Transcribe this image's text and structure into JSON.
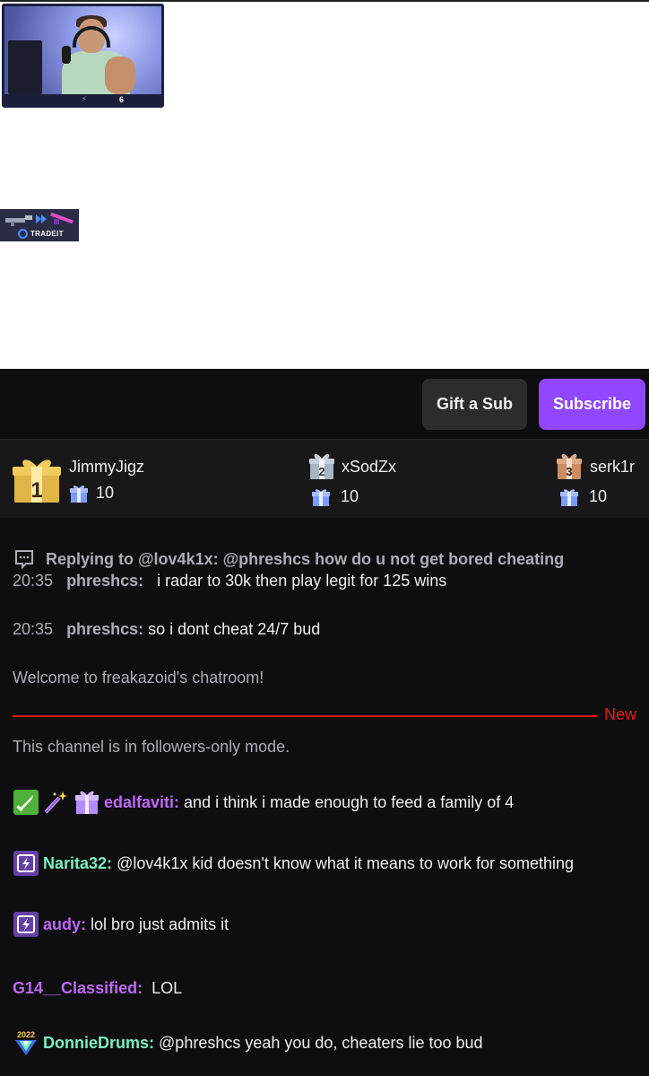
{
  "stream": {
    "webcam_counter": "6",
    "sponsor_name": "TRADEIT"
  },
  "actions": {
    "gift_label": "Gift a Sub",
    "subscribe_label": "Subscribe"
  },
  "leaderboard": [
    {
      "rank": "1",
      "name": "JimmyJigz",
      "count": "10"
    },
    {
      "rank": "2",
      "name": "xSodZx",
      "count": "10"
    },
    {
      "rank": "3",
      "name": "serk1r",
      "count": "10"
    }
  ],
  "chat": {
    "reply": {
      "header": "Replying to @lov4k1x: @phreshcs how do u not get bored cheating",
      "time": "20:35",
      "user": "phreshcs:",
      "text": "i radar to 30k then play legit for 125 wins"
    },
    "msg2": {
      "time": "20:35",
      "user": "phreshcs:",
      "text": "so i dont cheat 24/7 bud"
    },
    "welcome": "Welcome to freakazoid's chatroom!",
    "new_label": "New",
    "followers_notice": "This channel is in followers-only mode.",
    "messages": [
      {
        "user": "edalfaviti:",
        "text": "and i think i made enough to feed a family of 4",
        "color": "#bf68f5"
      },
      {
        "user": "Narita32:",
        "text": "@lov4k1x kid doesn't know what it means to work for something",
        "color": "#7bf0c1"
      },
      {
        "user": "audy:",
        "text": "lol bro just admits it",
        "color": "#bf68f5"
      },
      {
        "user": "G14__Classified:",
        "text": "LOL",
        "color": "#bf68f5"
      },
      {
        "user": "DonnieDrums:",
        "text": "@phreshcs yeah you do, cheaters lie too bud",
        "color": "#7bf0c1"
      }
    ],
    "badge_year": "2022"
  },
  "colors": {
    "accent": "#9147ff",
    "new_divider": "#e91916",
    "panel_bg": "#0e0e10"
  }
}
